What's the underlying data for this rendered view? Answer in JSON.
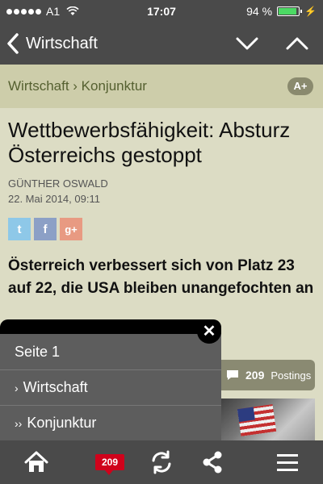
{
  "status": {
    "carrier": "A1",
    "time": "17:07",
    "battery": "94 %",
    "battery_level": 0.94
  },
  "nav": {
    "back_label": "Wirtschaft"
  },
  "breadcrumb": {
    "text": "Wirtschaft › Konjunktur",
    "font_button": "A+"
  },
  "article": {
    "headline": "Wettbewerbsfähigkeit: Absturz Österreichs gestoppt",
    "author": "GÜNTHER OSWALD",
    "date": "22. Mai 2014, 09:11",
    "share": {
      "twitter": "t",
      "facebook": "f",
      "gplus": "g+"
    },
    "lead": "Österreich verbessert sich von Platz 23 auf 22, die USA bleiben unangefochten an"
  },
  "postings": {
    "count": "209",
    "label": "Postings"
  },
  "menu": {
    "items": [
      {
        "arrow": "",
        "label": "Seite 1"
      },
      {
        "arrow": "›",
        "label": "Wirtschaft"
      },
      {
        "arrow": "››",
        "label": "Konjunktur"
      }
    ],
    "close": "✕"
  },
  "tabbar": {
    "comment_badge": "209"
  },
  "colors": {
    "bar": "#4a4a4a",
    "background": "#dcdcc4",
    "badge": "#d0021b",
    "battery": "#4cd964"
  }
}
